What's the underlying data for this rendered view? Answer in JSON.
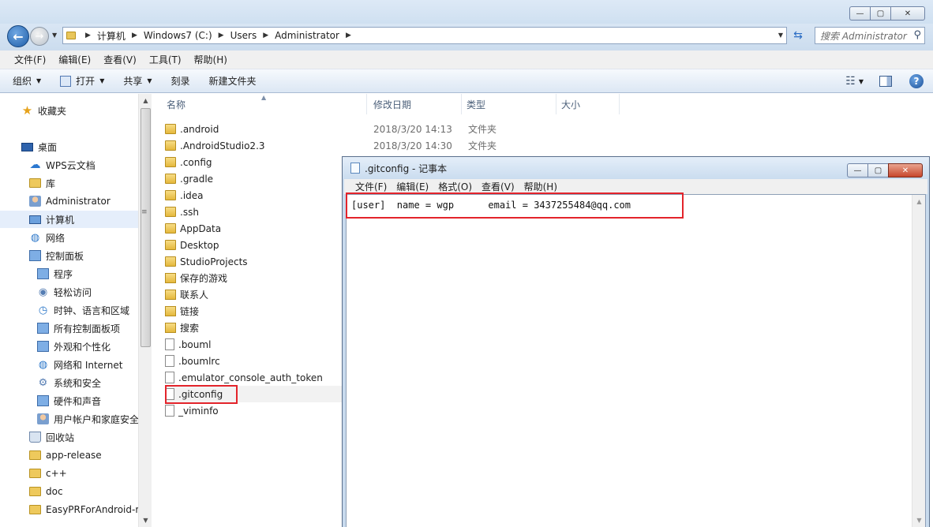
{
  "titlebar": {
    "minimize": "—",
    "maximize": "▢",
    "close": "✕"
  },
  "address": {
    "crumbs": [
      "计算机",
      "Windows7 (C:)",
      "Users",
      "Administrator"
    ],
    "search_placeholder": "搜索 Administrator"
  },
  "menubar": [
    "文件(F)",
    "编辑(E)",
    "查看(V)",
    "工具(T)",
    "帮助(H)"
  ],
  "commandbar": {
    "organize": "组织",
    "open": "打开",
    "share": "共享",
    "burn": "刻录",
    "new_folder": "新建文件夹"
  },
  "sidebar": {
    "items": [
      {
        "label": "收藏夹",
        "icon": "star-icon"
      },
      {
        "label": "桌面",
        "icon": "desktop-icon"
      },
      {
        "label": "WPS云文档",
        "icon": "cloud-icon"
      },
      {
        "label": "库",
        "icon": "library-icon"
      },
      {
        "label": "Administrator",
        "icon": "user-icon"
      },
      {
        "label": "计算机",
        "icon": "computer-icon"
      },
      {
        "label": "网络",
        "icon": "network-icon"
      },
      {
        "label": "控制面板",
        "icon": "control-panel-icon"
      },
      {
        "label": "程序",
        "icon": "programs-icon"
      },
      {
        "label": "轻松访问",
        "icon": "ease-of-access-icon"
      },
      {
        "label": "时钟、语言和区域",
        "icon": "clock-icon"
      },
      {
        "label": "所有控制面板项",
        "icon": "control-panel-icon"
      },
      {
        "label": "外观和个性化",
        "icon": "appearance-icon"
      },
      {
        "label": "网络和 Internet",
        "icon": "network-internet-icon"
      },
      {
        "label": "系统和安全",
        "icon": "system-security-icon"
      },
      {
        "label": "硬件和声音",
        "icon": "hardware-sound-icon"
      },
      {
        "label": "用户帐户和家庭安全",
        "icon": "user-accounts-icon"
      },
      {
        "label": "回收站",
        "icon": "recycle-bin-icon"
      },
      {
        "label": "app-release",
        "icon": "folder-icon"
      },
      {
        "label": "c++",
        "icon": "folder-icon"
      },
      {
        "label": "doc",
        "icon": "folder-icon"
      },
      {
        "label": "EasyPRForAndroid-m",
        "icon": "folder-icon"
      }
    ]
  },
  "filelist": {
    "columns": {
      "name": "名称",
      "date": "修改日期",
      "type": "类型",
      "size": "大小"
    },
    "rows": [
      {
        "name": ".android",
        "date": "2018/3/20 14:13",
        "type": "文件夹",
        "kind": "folder"
      },
      {
        "name": ".AndroidStudio2.3",
        "date": "2018/3/20 14:30",
        "type": "文件夹",
        "kind": "folder"
      },
      {
        "name": ".config",
        "date": "",
        "type": "",
        "kind": "folder"
      },
      {
        "name": ".gradle",
        "date": "",
        "type": "",
        "kind": "folder"
      },
      {
        "name": ".idea",
        "date": "",
        "type": "",
        "kind": "folder"
      },
      {
        "name": ".ssh",
        "date": "",
        "type": "",
        "kind": "folder"
      },
      {
        "name": "AppData",
        "date": "",
        "type": "",
        "kind": "folder"
      },
      {
        "name": "Desktop",
        "date": "",
        "type": "",
        "kind": "folder"
      },
      {
        "name": "StudioProjects",
        "date": "",
        "type": "",
        "kind": "folder"
      },
      {
        "name": "保存的游戏",
        "date": "",
        "type": "",
        "kind": "special"
      },
      {
        "name": "联系人",
        "date": "",
        "type": "",
        "kind": "special"
      },
      {
        "name": "链接",
        "date": "",
        "type": "",
        "kind": "special"
      },
      {
        "name": "搜索",
        "date": "",
        "type": "",
        "kind": "special"
      },
      {
        "name": ".bouml",
        "date": "",
        "type": "",
        "kind": "file"
      },
      {
        "name": ".boumlrc",
        "date": "",
        "type": "",
        "kind": "file"
      },
      {
        "name": ".emulator_console_auth_token",
        "date": "",
        "type": "",
        "kind": "file"
      },
      {
        "name": ".gitconfig",
        "date": "",
        "type": "",
        "kind": "file"
      },
      {
        "name": "_viminfo",
        "date": "",
        "type": "",
        "kind": "file"
      }
    ]
  },
  "notepad": {
    "title": ".gitconfig - 记事本",
    "menu": [
      "文件(F)",
      "编辑(E)",
      "格式(O)",
      "查看(V)",
      "帮助(H)"
    ],
    "content": "[user]  name = wgp      email = 3437255484@qq.com"
  }
}
